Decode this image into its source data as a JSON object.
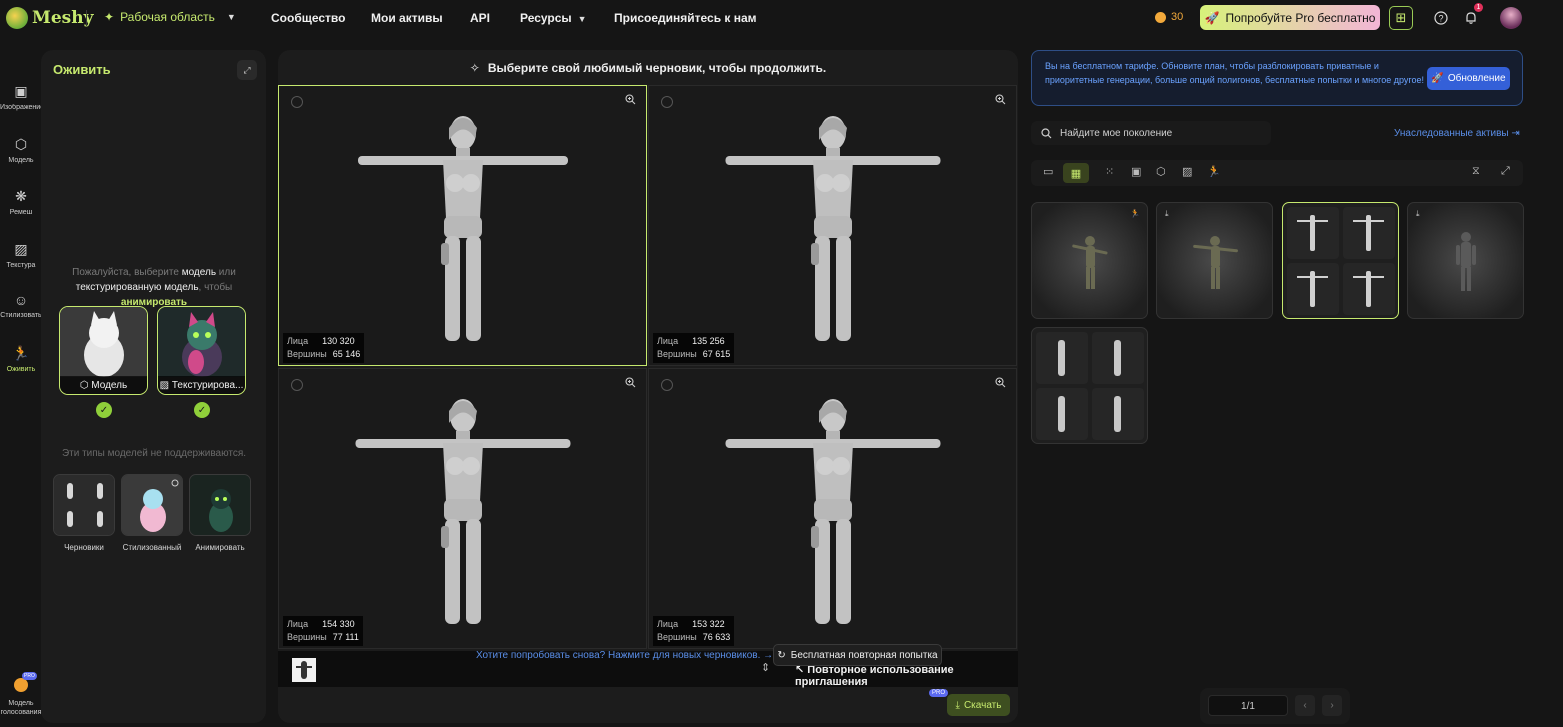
{
  "nav": {
    "logo": "Meshy",
    "workspace": "Рабочая область",
    "links": [
      "Сообщество",
      "Мои активы",
      "API",
      "Ресурсы",
      "Присоединяйтесь к нам"
    ],
    "credits": "30",
    "pro_button": "Попробуйте Pro бесплатно",
    "notification_count": "1"
  },
  "rail": {
    "items": [
      "Изображение",
      "Модель",
      "Ремеш",
      "Текстура",
      "Стилизовать",
      "Оживить"
    ],
    "bottom": "Модель голосования",
    "pro_tag": "PRO"
  },
  "left_panel": {
    "title": "Оживить",
    "hint": {
      "part1": "Пожалуйста, выберите ",
      "model": "модель",
      "part2": " или ",
      "textured": "текстурированную модель",
      "part3": ", чтобы ",
      "animate": "анимировать"
    },
    "supported": [
      {
        "label": "Модель",
        "icon": "cube-icon"
      },
      {
        "label": "Текстурирова...",
        "icon": "texture-icon"
      }
    ],
    "unsupported_text": "Эти типы моделей не поддерживаются.",
    "unsupported": [
      "Черновики",
      "Стилизованный",
      "Анимировать"
    ]
  },
  "center": {
    "header": "Выберите свой любимый черновик, чтобы продолжить.",
    "faces_label": "Лица",
    "verts_label": "Вершины",
    "drafts": [
      {
        "faces": "130 320",
        "verts": "65 146",
        "selected": true
      },
      {
        "faces": "135 256",
        "verts": "67 615",
        "selected": false
      },
      {
        "faces": "154 330",
        "verts": "77 111",
        "selected": false
      },
      {
        "faces": "153 322",
        "verts": "76 633",
        "selected": false
      }
    ],
    "reuse": "Повторное использование приглашения",
    "try_again": "Хотите попробовать снова? Нажмите для новых черновиков. →",
    "free_retry": "Бесплатная повторная попытка",
    "pro_tag": "PRO",
    "download": "Скачать"
  },
  "right": {
    "banner": "Вы на бесплатном тарифе. Обновите план, чтобы разблокировать приватные и приоритетные генерации, больше опций полигонов, бесплатные попытки и многое другое!",
    "upgrade": "Обновление",
    "search_placeholder": "Найдите мое поколение",
    "legacy": "Унаследованные активы",
    "pager": "1/1"
  },
  "colors": {
    "accent": "#c6e96e",
    "link": "#5a8ee8",
    "upgrade": "#3460d8"
  }
}
